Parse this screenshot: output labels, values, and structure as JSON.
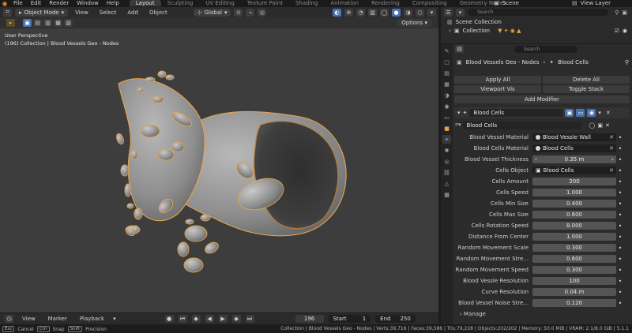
{
  "menu": {
    "file": "File",
    "edit": "Edit",
    "render": "Render",
    "window": "Window",
    "help": "Help"
  },
  "workspaces": [
    "Layout",
    "Sculpting",
    "UV Editing",
    "Texture Paint",
    "Shading",
    "Animation",
    "Rendering",
    "Compositing",
    "Geometry Nodes"
  ],
  "top_right": {
    "scene": "Scene",
    "view_layer": "View Layer"
  },
  "viewport_header": {
    "mode": "Object Mode",
    "view": "View",
    "select": "Select",
    "add": "Add",
    "object": "Object",
    "orientation": "Global"
  },
  "viewport": {
    "perspective": "User Perspective",
    "context": "(196) Collection | Blood Vessels Geo - Nodes",
    "options": "Options"
  },
  "timeline": {
    "view": "View",
    "marker": "Marker",
    "playback": "Playback",
    "current_frame": "196",
    "start_label": "Start",
    "start": "1",
    "end_label": "End",
    "end": "250"
  },
  "statusbar": {
    "cancel_key": "Esc",
    "cancel": "Cancel",
    "snap_key": "Ctrl",
    "snap": "Snap",
    "precision_key": "Shift",
    "precision": "Precision",
    "stats": "Collection | Blood Vessels Geo - Nodes | Verts:39,716 | Faces:39,586 | Tris:79,228 | Objects:202/202 | Memory: 50.0 MiB | VRAM: 2.1/8.0 GiB | 5.1.1"
  },
  "outliner": {
    "search_placeholder": "Search",
    "scene_collection": "Scene Collection",
    "collection": "Collection"
  },
  "properties": {
    "search_placeholder": "Search",
    "breadcrumb_object": "Blood Vessels Geo - Nodes",
    "breadcrumb_modifier": "Blood Cells",
    "apply_all": "Apply All",
    "delete_all": "Delete All",
    "viewport_vis": "Viewport Vis",
    "toggle_stack": "Toggle Stack",
    "add_modifier": "Add Modifier",
    "modifier_name": "Blood Cells",
    "node_group": "Blood Cells",
    "fields": [
      {
        "label": "Blood Vessel Material",
        "type": "material",
        "value": "Blood Vessle Wall"
      },
      {
        "label": "Blood Cells Material",
        "type": "material",
        "value": "Blood Cells"
      },
      {
        "label": "Blood Vessel Thickness",
        "type": "arrow",
        "value": "0.35 m"
      },
      {
        "label": "Cells Object",
        "type": "object",
        "value": "Blood Cells"
      },
      {
        "label": "Cells Amount",
        "type": "number",
        "value": "200"
      },
      {
        "label": "Cells Speed",
        "type": "number",
        "value": "1.000"
      },
      {
        "label": "Cells Min Size",
        "type": "number",
        "value": "0.400"
      },
      {
        "label": "Cells Max Size",
        "type": "number",
        "value": "0.600"
      },
      {
        "label": "Cells Rotation Speed",
        "type": "number",
        "value": "8.000"
      },
      {
        "label": "Distance From Center",
        "type": "number",
        "value": "1.000"
      },
      {
        "label": "Random Movement Scale",
        "type": "number",
        "value": "0.300"
      },
      {
        "label": "Random Movement Stre...",
        "type": "number",
        "value": "0.600"
      },
      {
        "label": "Random Movement Speed",
        "type": "number",
        "value": "0.300"
      },
      {
        "label": "Blood Vessle Resolution",
        "type": "number",
        "value": "100"
      },
      {
        "label": "Curve Resolution",
        "type": "number",
        "value": "0.04 m"
      },
      {
        "label": "Blood Vessel Noise Stre...",
        "type": "number",
        "value": "0.120"
      }
    ],
    "manage": "Manage"
  },
  "colors": {
    "accent": "#4772b3",
    "active_object": "#e8a34a",
    "app_bg": "#1d1d1d",
    "viewport_bg": "#3d3d3d"
  }
}
